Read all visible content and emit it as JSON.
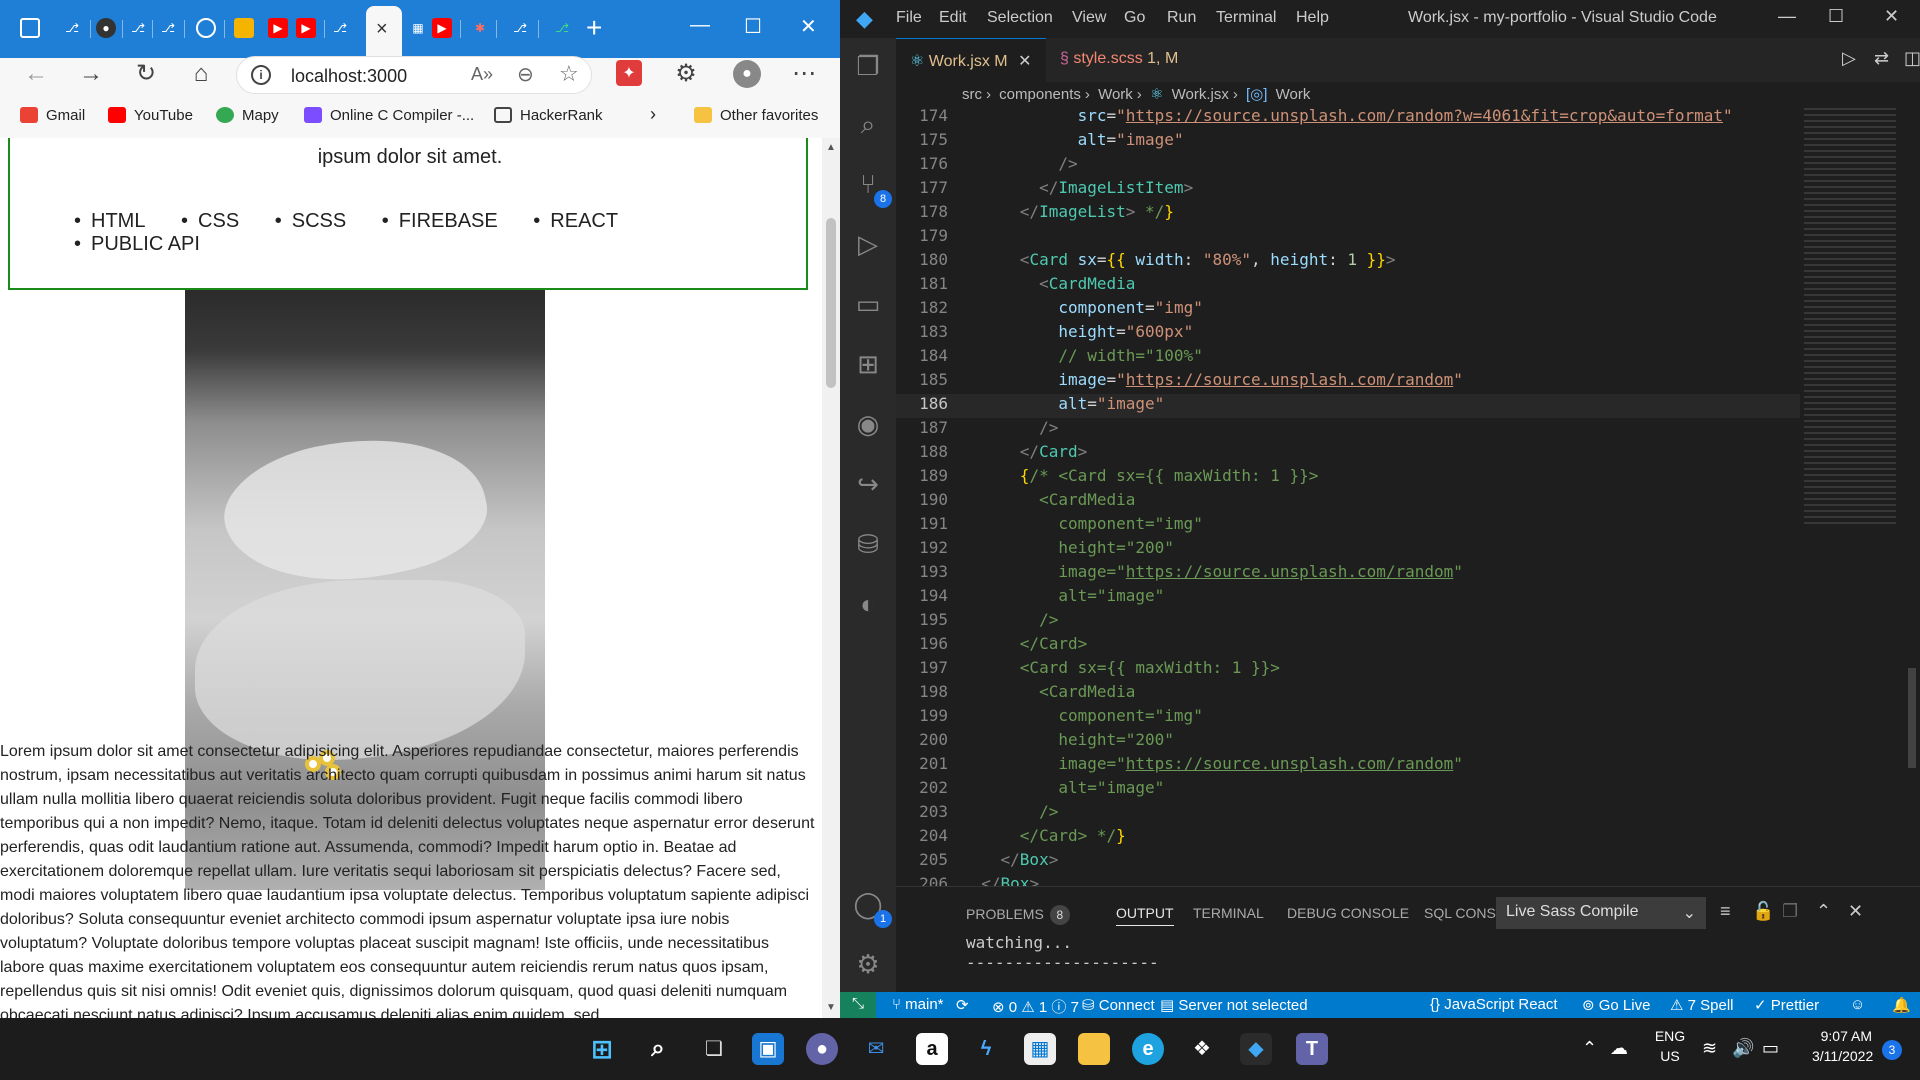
{
  "browser": {
    "tab_close": "×",
    "new_tab": "+",
    "address": "localhost:3000",
    "bookmarks": [
      {
        "label": "Gmail",
        "color": "#ea4335"
      },
      {
        "label": "YouTube",
        "color": "#ff0000"
      },
      {
        "label": "Mapy",
        "color": "#34a853"
      },
      {
        "label": "Online C Compiler -...",
        "color": "#7c4dff"
      },
      {
        "label": "HackerRank",
        "color": "#f7f7f7"
      },
      {
        "label": "Other favorites",
        "color": "#f5c242"
      }
    ],
    "page": {
      "hero_text": "ipsum dolor sit amet.",
      "tech": [
        "HTML",
        "CSS",
        "SCSS",
        "FIREBASE",
        "REACT",
        "PUBLIC API"
      ],
      "lorem": "Lorem ipsum dolor sit amet consectetur adipisicing elit. Asperiores repudiandae consectetur, maiores perferendis nostrum, ipsam necessitatibus aut veritatis architecto quam corrupti quibusdam in possimus animi harum sit natus ullam nulla mollitia libero quaerat reiciendis soluta doloribus provident. Fugit neque facilis commodi libero temporibus qui a non impedit? Nemo, itaque. Totam id deleniti delectus voluptates neque aspernatur error deserunt perferendis, quas odit laudantium ratione aut. Assumenda, commodi? Impedit harum optio in. Beatae ad exercitationem doloremque repellat ullam. Iure veritatis sequi laboriosam sit perspiciatis delectus? Facere sed, modi maiores voluptatem libero quae laudantium ipsa voluptate delectus. Temporibus voluptatum sapiente adipisci doloribus? Soluta consequuntur eveniet architecto commodi ipsum aspernatur voluptate ipsa iure nobis voluptatum? Voluptate doloribus tempore voluptas placeat suscipit magnam! Iste officiis, unde necessitatibus labore quas maxime exercitationem voluptatem eos consequuntur autem reiciendis rerum natus quos ipsam, repellendus quis sit nisi omnis! Odit eveniet quis, dignissimos dolorum quisquam, quod quasi deleniti numquam obcaecati nesciunt natus adipisci? Ipsum accusamus deleniti alias enim quidem, sed"
    }
  },
  "vscode": {
    "menu": [
      "File",
      "Edit",
      "Selection",
      "View",
      "Go",
      "Run",
      "Terminal",
      "Help"
    ],
    "title": "Work.jsx - my-portfolio - Visual Studio Code",
    "tabs": [
      {
        "label": "Work.jsx",
        "status": "M"
      },
      {
        "label": "style.scss",
        "status": "1, M"
      }
    ],
    "breadcrumb": [
      "src",
      "components",
      "Work",
      "Work.jsx",
      "Work"
    ],
    "line_numbers": [
      "174",
      "175",
      "176",
      "177",
      "178",
      "179",
      "180",
      "181",
      "182",
      "183",
      "184",
      "185",
      "186",
      "187",
      "188",
      "189",
      "190",
      "191",
      "192",
      "193",
      "194",
      "195",
      "196",
      "197",
      "198",
      "199",
      "200",
      "201",
      "202",
      "203",
      "204",
      "205",
      "206"
    ],
    "code": {
      "174_url": "https://source.unsplash.com/random?w=4061&fit=crop&auto=format",
      "random_url": "https://source.unsplash.com/random",
      "h600": "\"600px\"",
      "h200": "\"200\"",
      "width_comment": "// width=\"100%\""
    },
    "panel": {
      "tabs": [
        "PROBLEMS",
        "OUTPUT",
        "TERMINAL",
        "DEBUG CONSOLE",
        "SQL CONSOLE"
      ],
      "problems_count": "8",
      "output_source": "Live Sass Compile",
      "output_lines": "watching...\n--------------------"
    },
    "statusbar": {
      "branch": "main*",
      "errors": "0",
      "warnings": "1",
      "infos": "7",
      "connect": "Connect",
      "server": "Server not selected",
      "language": "JavaScript React",
      "golive": "Go Live",
      "spell": "7 Spell",
      "prettier": "Prettier"
    },
    "badges": {
      "scm": "8",
      "accounts": "1"
    }
  },
  "taskbar": {
    "lang_top": "ENG",
    "lang_bottom": "US",
    "time": "9:07 AM",
    "date": "3/11/2022",
    "notifications": "3"
  }
}
